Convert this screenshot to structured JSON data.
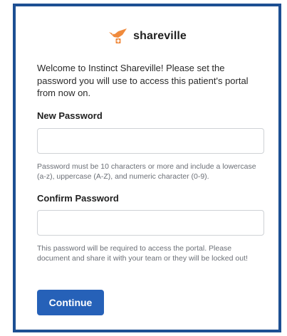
{
  "brand": {
    "name": "shareville",
    "icon": "shareville-bird-logo-icon",
    "color": "#f08a3c"
  },
  "intro": {
    "text": "Welcome to Instinct Shareville! Please set the password you will use to access this patient's portal from now on."
  },
  "new_password": {
    "label": "New Password",
    "value": "",
    "placeholder": "",
    "hint": "Password must be 10 characters or more and include a lowercase (a-z), uppercase (A-Z), and numeric character (0-9)."
  },
  "confirm_password": {
    "label": "Confirm Password",
    "value": "",
    "placeholder": "",
    "hint": "This password will be required to access the portal. Please document and share it with your team or they will be locked out!"
  },
  "actions": {
    "continue_label": "Continue"
  },
  "colors": {
    "frame_border": "#1d4f93",
    "primary_button": "#2661b8",
    "hint_text": "#6b6f76"
  }
}
